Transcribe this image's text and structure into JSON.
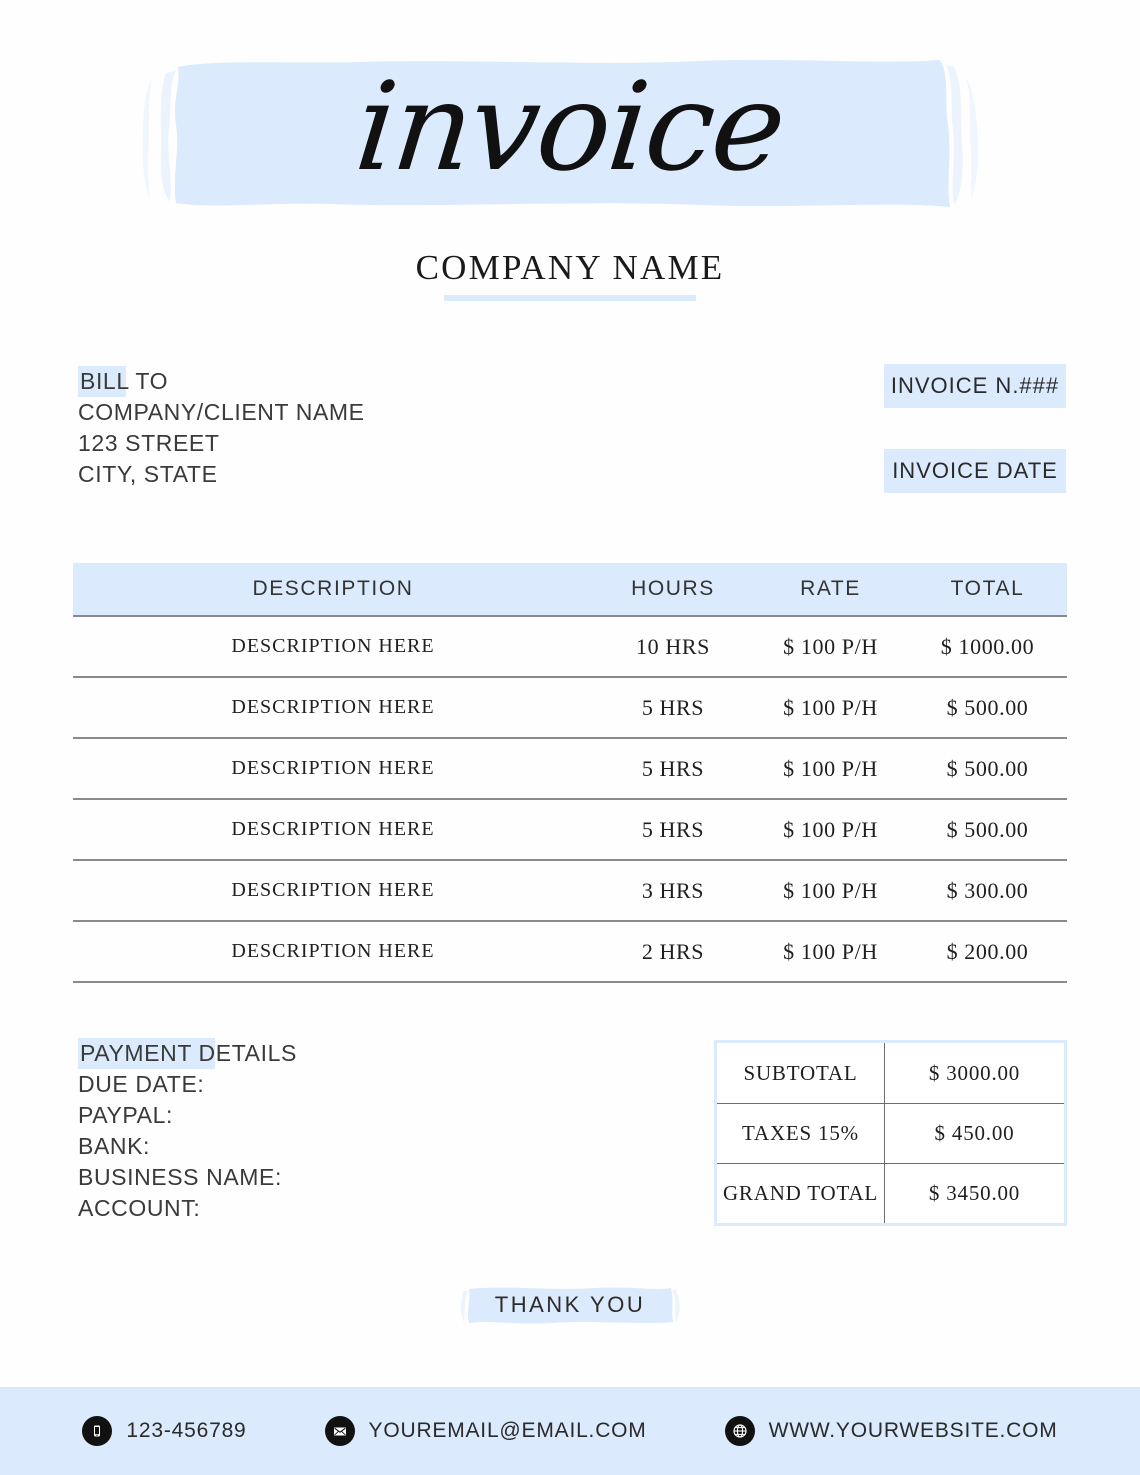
{
  "header": {
    "title": "invoice",
    "company_name": "COMPANY NAME",
    "brush_color": "#dbeafc"
  },
  "bill_to": {
    "heading": "BILL TO",
    "lines": [
      "COMPANY/CLIENT NAME",
      "123 STREET",
      "CITY, STATE"
    ]
  },
  "invoice_meta": {
    "number_label": "INVOICE N.###",
    "date_label": "INVOICE DATE"
  },
  "table": {
    "columns": [
      "DESCRIPTION",
      "HOURS",
      "RATE",
      "TOTAL"
    ],
    "rows": [
      {
        "description": "DESCRIPTION HERE",
        "hours": "10 HRS",
        "rate": "$ 100 P/H",
        "total": "$ 1000.00"
      },
      {
        "description": "DESCRIPTION HERE",
        "hours": "5 HRS",
        "rate": "$ 100 P/H",
        "total": "$ 500.00"
      },
      {
        "description": "DESCRIPTION HERE",
        "hours": "5 HRS",
        "rate": "$ 100 P/H",
        "total": "$ 500.00"
      },
      {
        "description": "DESCRIPTION HERE",
        "hours": "5 HRS",
        "rate": "$ 100 P/H",
        "total": "$ 500.00"
      },
      {
        "description": "DESCRIPTION HERE",
        "hours": "3 HRS",
        "rate": "$ 100 P/H",
        "total": "$ 300.00"
      },
      {
        "description": "DESCRIPTION HERE",
        "hours": "2 HRS",
        "rate": "$ 100 P/H",
        "total": "$ 200.00"
      }
    ]
  },
  "payment_details": {
    "heading": "PAYMENT DETAILS",
    "lines": [
      "DUE DATE:",
      "PAYPAL:",
      "BANK:",
      "BUSINESS NAME:",
      "ACCOUNT:"
    ]
  },
  "totals": {
    "rows": [
      {
        "label": "SUBTOTAL",
        "value": "$ 3000.00"
      },
      {
        "label": "TAXES 15%",
        "value": "$  450.00"
      },
      {
        "label": "GRAND TOTAL",
        "value": "$ 3450.00"
      }
    ]
  },
  "thank_you": {
    "text": "THANK YOU"
  },
  "footer": {
    "contacts": [
      {
        "icon": "phone-icon",
        "text": "123-456789"
      },
      {
        "icon": "email-icon",
        "text": "YOUREMAIL@EMAIL.COM"
      },
      {
        "icon": "globe-icon",
        "text": "WWW.YOURWEBSITE.COM"
      }
    ]
  }
}
